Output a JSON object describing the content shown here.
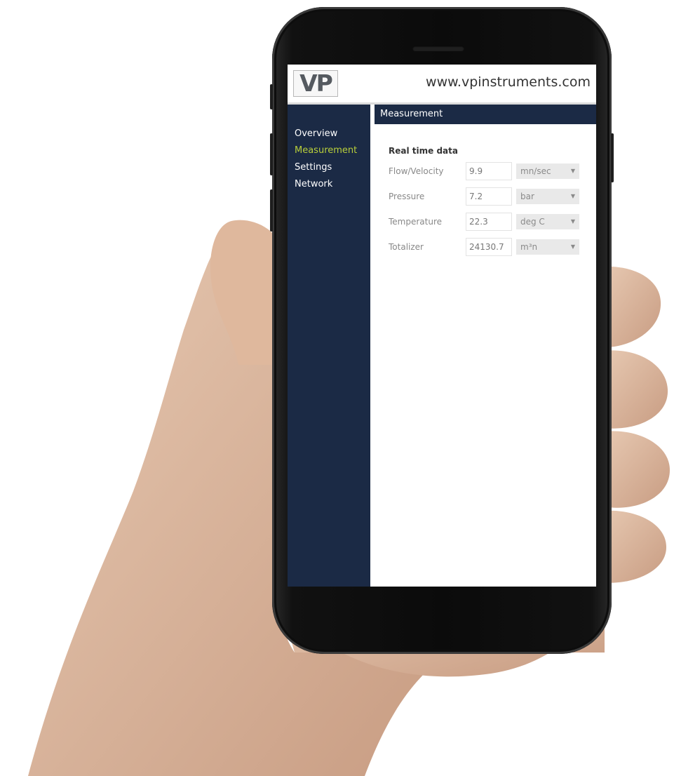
{
  "header": {
    "logo_text": "VP",
    "site_url": "www.vpinstruments.com"
  },
  "sidebar": {
    "items": [
      {
        "label": "Overview",
        "active": false
      },
      {
        "label": "Measurement",
        "active": true
      },
      {
        "label": "Settings",
        "active": false
      },
      {
        "label": "Network",
        "active": false
      }
    ]
  },
  "content": {
    "header_title": "Measurement",
    "section_title": "Real time data",
    "rows": [
      {
        "label": "Flow/Velocity",
        "value": "9.9",
        "unit": "mn/sec"
      },
      {
        "label": "Pressure",
        "value": "7.2",
        "unit": "bar"
      },
      {
        "label": "Temperature",
        "value": "22.3",
        "unit": "deg C"
      },
      {
        "label": "Totalizer",
        "value": "24130.7",
        "unit": "m³n"
      }
    ]
  },
  "colors": {
    "navy": "#1b2a45",
    "active_nav": "#b9cf3a"
  },
  "icons": {
    "dropdown": "chevron-down-icon"
  }
}
